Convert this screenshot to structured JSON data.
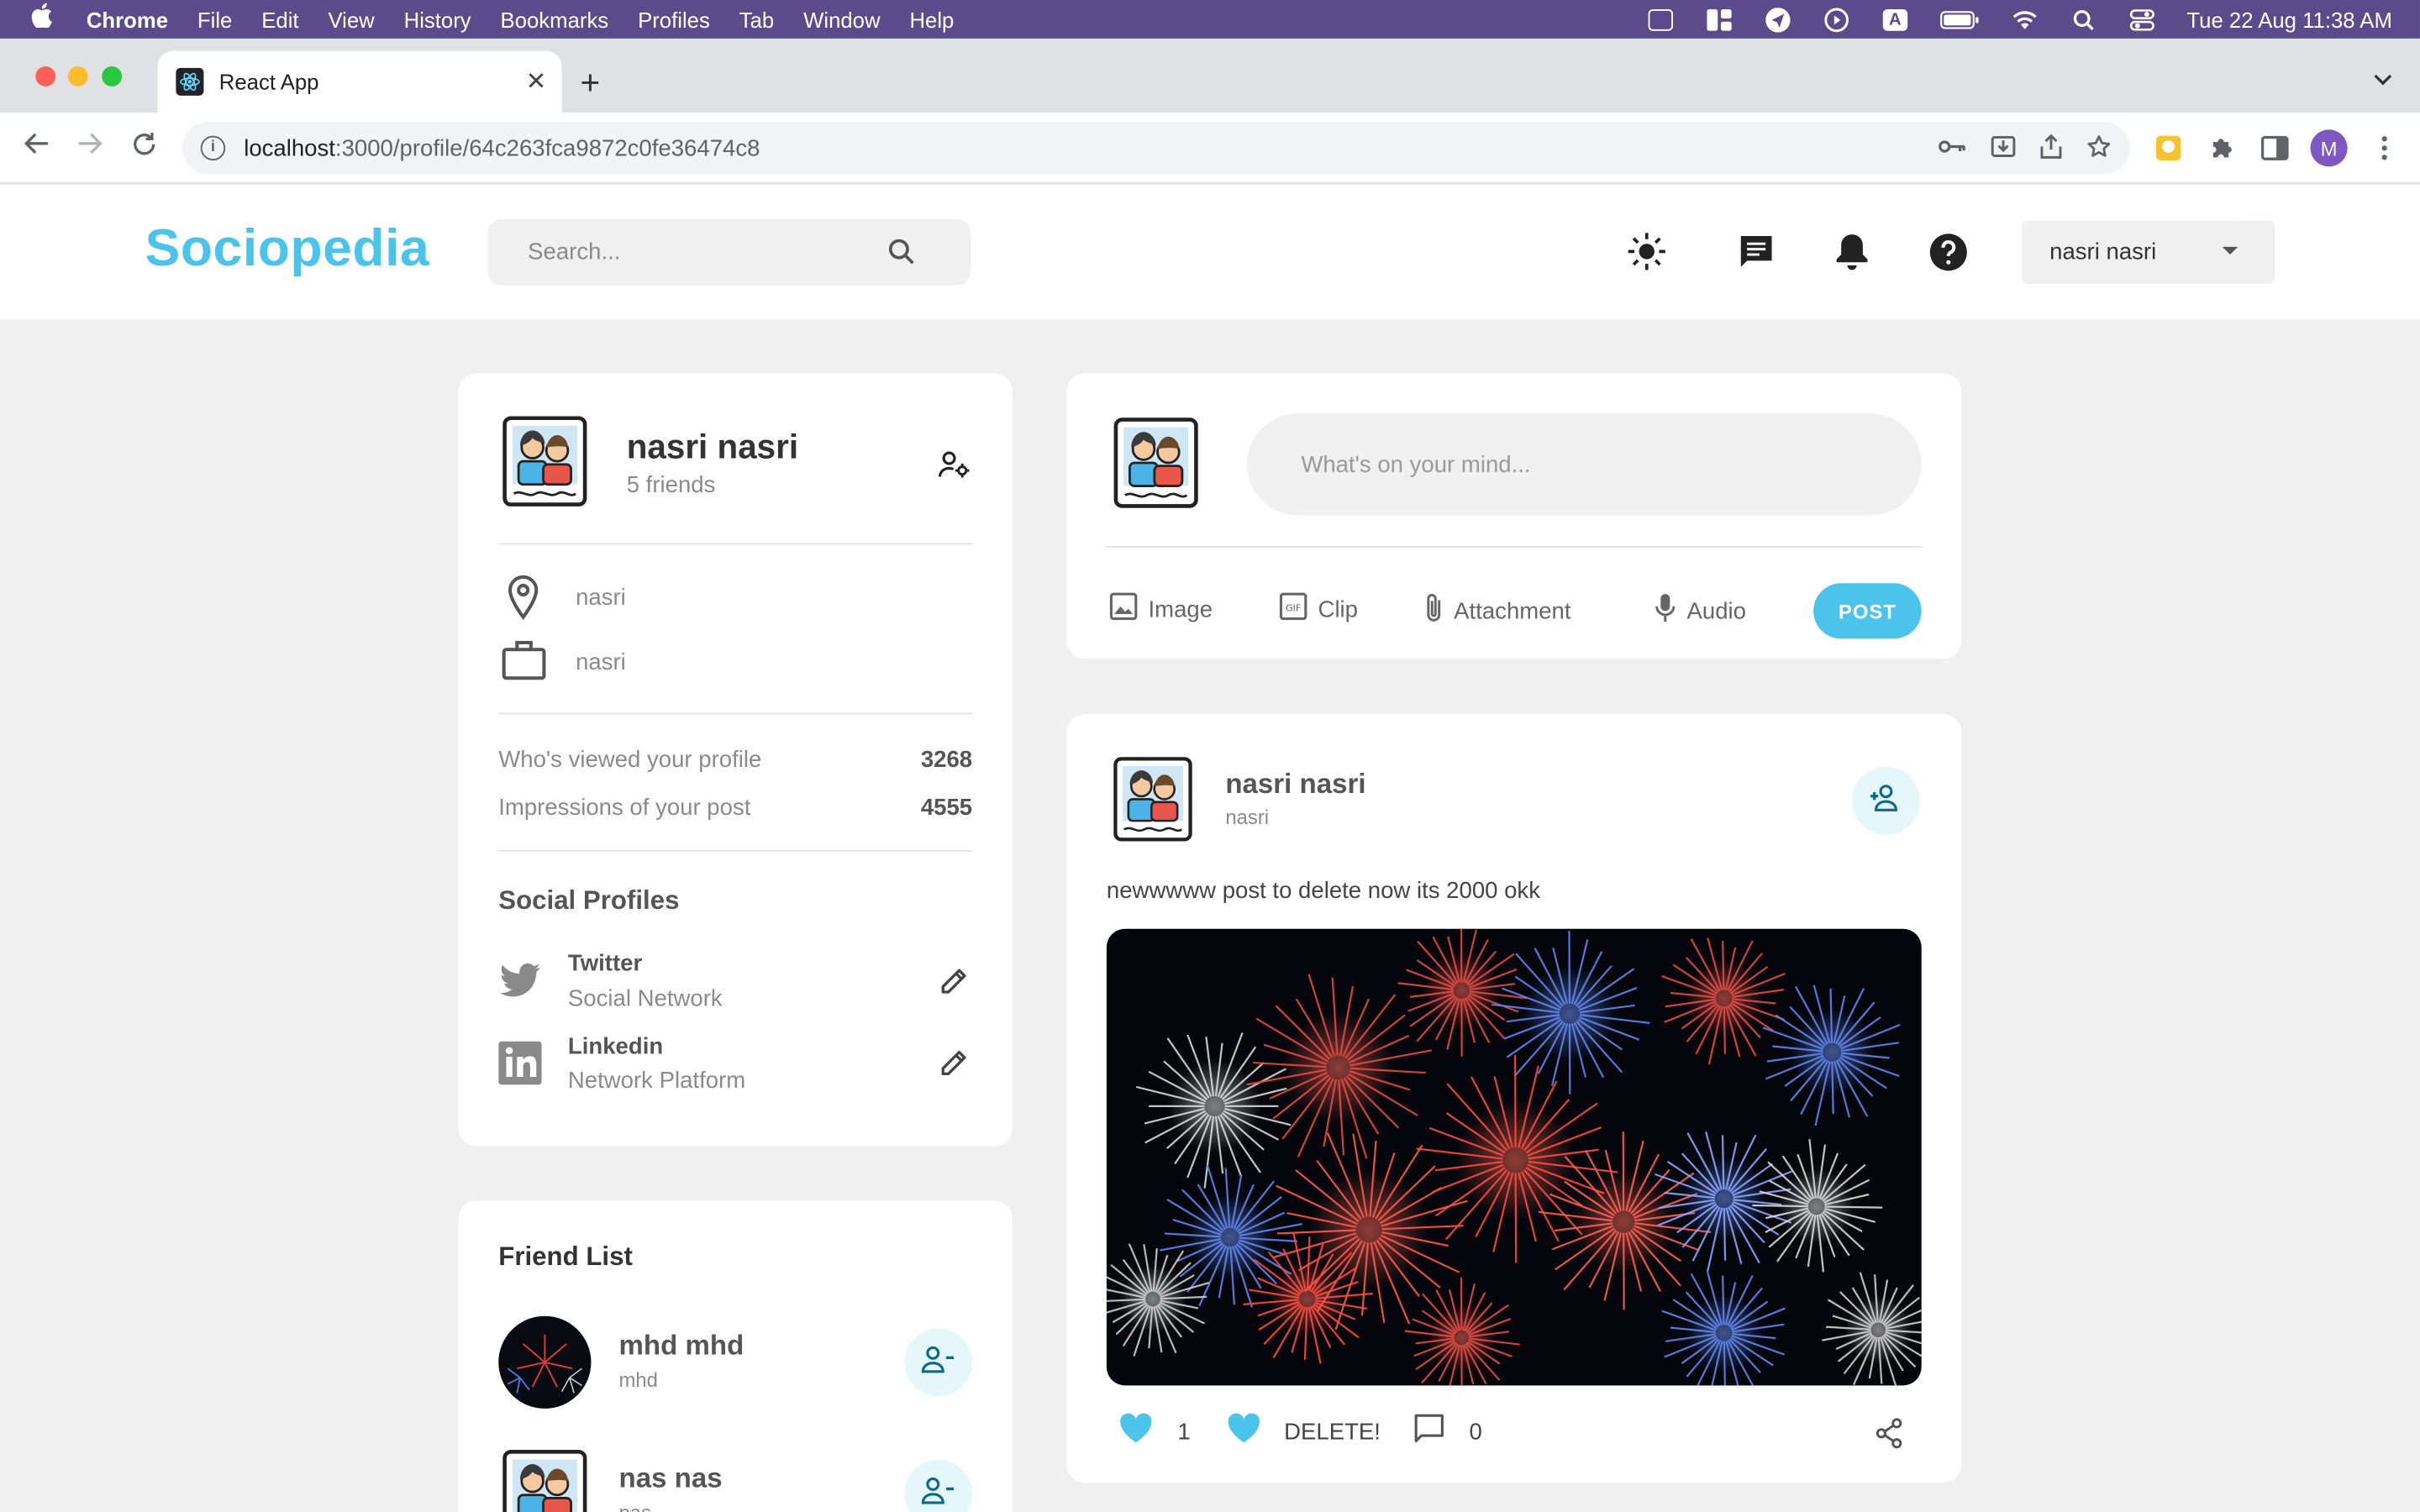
{
  "menubar": {
    "app": "Chrome",
    "items": [
      "File",
      "Edit",
      "View",
      "History",
      "Bookmarks",
      "Profiles",
      "Tab",
      "Window",
      "Help"
    ],
    "status_a_icon_text": "A",
    "clock": "Tue 22 Aug  11:38 AM"
  },
  "browser": {
    "tab_title": "React App",
    "url_host": "localhost",
    "url_path": ":3000/profile/64c263fca9872c0fe36474c8",
    "profile_initial": "M"
  },
  "nav": {
    "logo": "Sociopedia",
    "search_placeholder": "Search...",
    "user_select": "nasri nasri"
  },
  "profile_card": {
    "name": "nasri nasri",
    "friends": "5 friends",
    "location": "nasri",
    "occupation": "nasri",
    "stats": [
      {
        "label": "Who's viewed your profile",
        "value": "3268"
      },
      {
        "label": "Impressions of your post",
        "value": "4555"
      }
    ],
    "social_title": "Social Profiles",
    "socials": [
      {
        "name": "Twitter",
        "desc": "Social Network"
      },
      {
        "name": "Linkedin",
        "desc": "Network Platform"
      }
    ]
  },
  "composer": {
    "placeholder": "What's on your mind...",
    "actions": [
      "Image",
      "Clip",
      "Attachment",
      "Audio"
    ],
    "post_label": "POST"
  },
  "post": {
    "author": "nasri nasri",
    "location": "nasri",
    "text": "newwwww post to delete now its 2000 okk",
    "likes": "1",
    "delete_label": "DELETE!",
    "comments": "0"
  },
  "friends": {
    "title": "Friend List",
    "items": [
      {
        "name": "mhd mhd",
        "sub": "mhd"
      },
      {
        "name": "nas nas",
        "sub": "nas"
      }
    ]
  },
  "colors": {
    "accent": "#4cc3ea",
    "menubar": "#5b4b8a",
    "page_bg": "#f0f0f0"
  }
}
